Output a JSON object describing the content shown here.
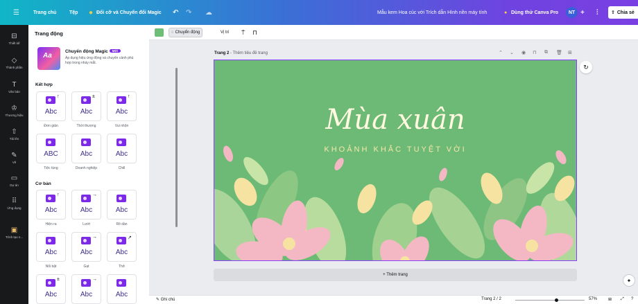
{
  "topbar": {
    "home": "Trang chủ",
    "file": "Tệp",
    "magic": "Đổi cỡ và Chuyển đổi Magic",
    "doc_title": "Mẫu kem Hoa cúc với Trích dẫn Hình nền máy tính",
    "try_pro": "Dùng thử Canva Pro",
    "avatar": "NT",
    "share": "Chia sẻ"
  },
  "rail": [
    {
      "label": "Thiết kế",
      "icon": "layout-icon"
    },
    {
      "label": "Thành phần",
      "icon": "shapes-icon"
    },
    {
      "label": "Văn bản",
      "icon": "text-icon"
    },
    {
      "label": "Thương hiệu",
      "icon": "brand-icon"
    },
    {
      "label": "Tải lên",
      "icon": "upload-icon"
    },
    {
      "label": "Vẽ",
      "icon": "draw-icon"
    },
    {
      "label": "Dự án",
      "icon": "folder-icon"
    },
    {
      "label": "Ứng dụng",
      "icon": "apps-icon"
    },
    {
      "label": "Trình tạo n...",
      "icon": "generator-icon"
    }
  ],
  "panel": {
    "title": "Trang động",
    "magic_title": "Chuyển động Magic",
    "magic_badge": "Mới",
    "magic_desc": "Áp dụng hiệu ứng động và chuyển cảnh phù hợp trong nháy mắt.",
    "section_combo": "Kết hợp",
    "section_basic": "Cơ bản",
    "combo": [
      {
        "label": "Đơn giản",
        "arrow": "↑",
        "abc": "Abc"
      },
      {
        "label": "Thời thượng",
        "arrow": "±",
        "abc": "Abc"
      },
      {
        "label": "Vui nhộn",
        "arrow": "↑",
        "abc": "Abc"
      },
      {
        "label": "Tiệc tùng",
        "arrow": "",
        "abc": "ABC"
      },
      {
        "label": "Doanh nghiệp",
        "arrow": "",
        "abc": "Abc"
      },
      {
        "label": "Chill",
        "arrow": "",
        "abc": "Abc"
      }
    ],
    "basic": [
      {
        "label": "Hiện ra",
        "arrow": "↑",
        "abc": "Abc"
      },
      {
        "label": "Lướt",
        "arrow": "→",
        "abc": "Abc"
      },
      {
        "label": "Rõ dần",
        "arrow": "",
        "abc": "Abc"
      },
      {
        "label": "Nổi bật",
        "arrow": "",
        "abc": "Abc"
      },
      {
        "label": "Gạt",
        "arrow": "→",
        "abc": "Abc"
      },
      {
        "label": "Thở",
        "arrow": "↗",
        "abc": "Abc"
      },
      {
        "label": "",
        "arrow": "±",
        "abc": "Abc"
      },
      {
        "label": "",
        "arrow": "→",
        "abc": "Abc"
      },
      {
        "label": "",
        "arrow": "",
        "abc": "Abc"
      }
    ]
  },
  "toolbar": {
    "animate": "Chuyển động",
    "position": "Vị trí"
  },
  "canvas": {
    "page_label": "Trang 2",
    "page_hint": " - Thêm tiêu đề trang",
    "title": "Mùa xuân",
    "subtitle": "KHOẢNH KHẮC TUYỆT VỜI",
    "add_page": "+ Thêm trang"
  },
  "bottombar": {
    "notes": "Ghi chú",
    "pages": "Trang 2 / 2",
    "zoom": "57%",
    "zoom_level": 0.57
  },
  "colors": {
    "slide_bg": "#6dba77",
    "accent": "#7d2ae8",
    "petal_pink": "#f4b8c4",
    "petal_yellow": "#f7e3a1"
  }
}
